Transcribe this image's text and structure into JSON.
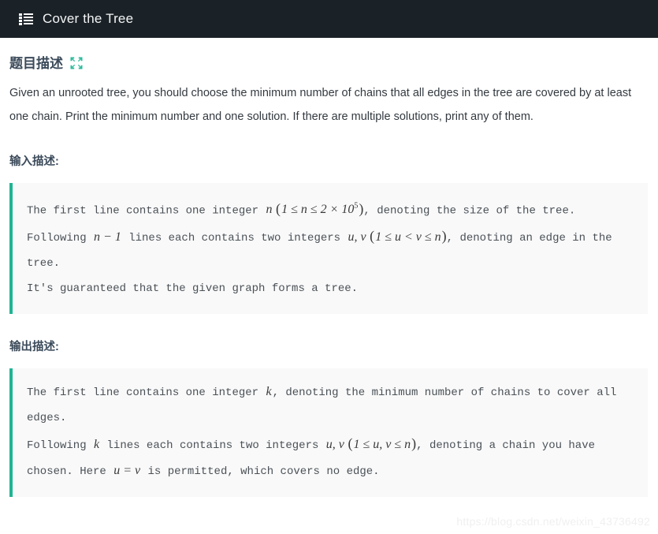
{
  "header": {
    "icon": "list-icon",
    "title": "Cover the Tree",
    "background_color": "#1b2227",
    "text_color": "#f3f5f6"
  },
  "problem": {
    "title": "题目描述",
    "expand_icon": "expand-arrows-icon",
    "accent_color": "#20b494",
    "description": "Given an unrooted tree, you should choose the minimum number of chains that all edges in the tree are covered by at least one chain. Print the minimum number and one solution. If there are multiple solutions, print any of them."
  },
  "input_section": {
    "title": "输入描述:",
    "lines": {
      "l1_a": "The first line contains one integer ",
      "l1_math_var": "n",
      "l1_math_cond": "1 ≤ n ≤ 2 × 10",
      "l1_math_exp": "5",
      "l1_b": ", denoting the size of the tree.",
      "l2_a": "Following ",
      "l2_math": "n − 1",
      "l2_b": " lines each contains two integers ",
      "l2_math_vars": "u, v",
      "l2_math_cond": "1 ≤ u < v ≤ n",
      "l2_c": ", denoting an edge in the tree.",
      "l3": "It's guaranteed that the given graph forms a tree."
    }
  },
  "output_section": {
    "title": "输出描述:",
    "lines": {
      "l1_a": "The first line contains one integer ",
      "l1_math": "k",
      "l1_b": ", denoting the minimum number of chains to cover all edges.",
      "l2_a": "Following ",
      "l2_math": "k",
      "l2_b": " lines each contains two integers ",
      "l2_math_vars": "u, v",
      "l2_math_cond": "1 ≤ u, v ≤ n",
      "l2_c": ", denoting a chain you have chosen. Here ",
      "l2_math_eq": "u = v",
      "l2_d": " is permitted, which covers no edge."
    }
  },
  "watermark": {
    "text": "https://blog.csdn.net/weixin_43736492"
  }
}
